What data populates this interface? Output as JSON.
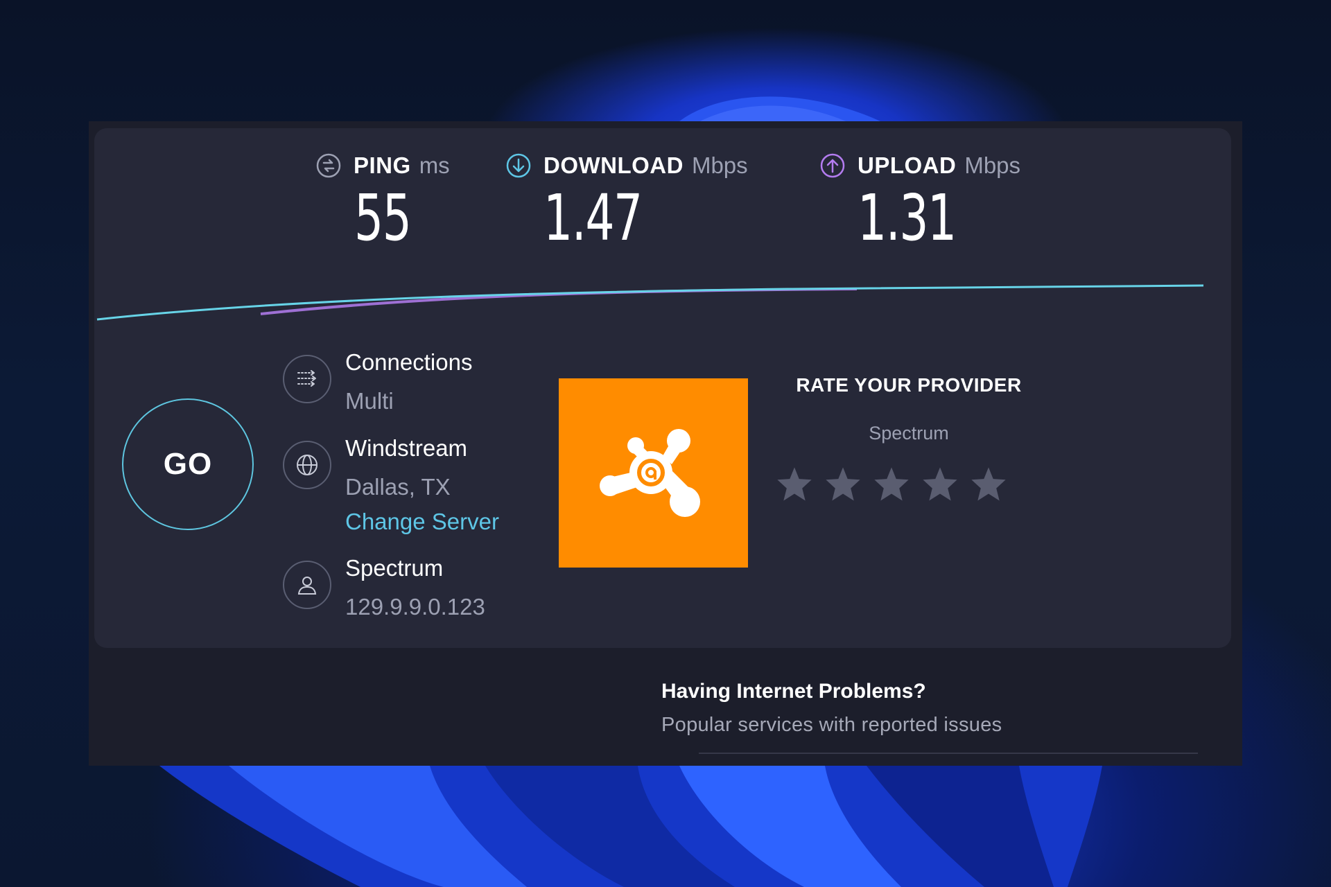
{
  "metrics": {
    "ping": {
      "label": "PING",
      "unit": "ms",
      "value": "55"
    },
    "download": {
      "label": "DOWNLOAD",
      "unit": "Mbps",
      "value": "1.47"
    },
    "upload": {
      "label": "UPLOAD",
      "unit": "Mbps",
      "value": "1.31"
    }
  },
  "go_button": {
    "label": "GO"
  },
  "connections": {
    "title": "Connections",
    "value": "Multi"
  },
  "server": {
    "name": "Windstream",
    "location": "Dallas, TX",
    "change_link": "Change Server"
  },
  "provider": {
    "name": "Spectrum",
    "ip": "129.9.9.0.123"
  },
  "rating": {
    "title": "RATE YOUR PROVIDER",
    "provider": "Spectrum",
    "stars_total": 5,
    "stars_selected": 0
  },
  "problems": {
    "title": "Having Internet Problems?",
    "subtitle": "Popular services with reported issues"
  },
  "colors": {
    "card_bg": "#262838",
    "accent_cyan": "#5ec6e6",
    "accent_purple": "#b47cf0",
    "ad_orange": "#ff8c00",
    "star_gray": "#5a5d70"
  },
  "icons": {
    "ping": "ping-icon",
    "download": "download-arrow-icon",
    "upload": "upload-arrow-icon",
    "connections": "connections-icon",
    "server": "globe-icon",
    "provider": "user-icon",
    "ad": "avast-logo-icon"
  }
}
